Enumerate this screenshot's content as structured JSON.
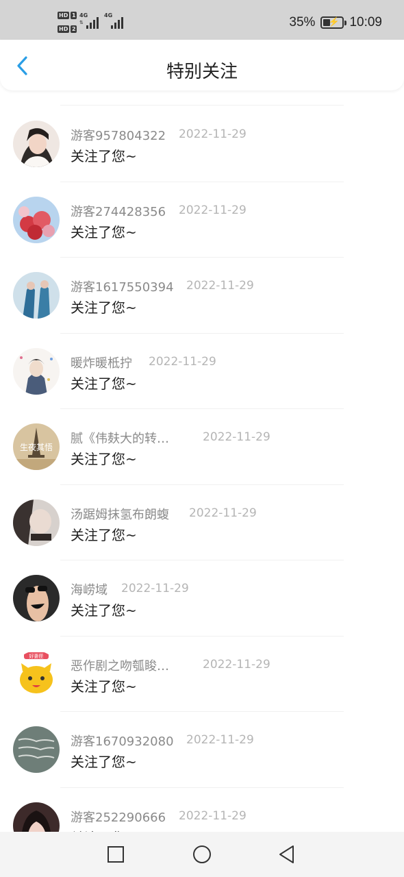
{
  "status_bar": {
    "hd_label": "HD",
    "sim1": "1",
    "sim2": "2",
    "network": "4G",
    "battery_percent": "35%",
    "battery_level": 0.35,
    "time": "10:09"
  },
  "header": {
    "title": "特别关注",
    "back_icon": "chevron-left-icon",
    "accent_color": "#2a9ee6"
  },
  "list": {
    "items": [
      {
        "name": "游客957804322",
        "date": "2022-11-29",
        "message": "关注了您~"
      },
      {
        "name": "游客274428356",
        "date": "2022-11-29",
        "message": "关注了您~"
      },
      {
        "name": "游客1617550394",
        "date": "2022-11-29",
        "message": "关注了您~"
      },
      {
        "name": "暖炸暖柢拧",
        "date": "2022-11-29",
        "message": "关注了您~"
      },
      {
        "name": "腻《伟麸大的转…",
        "date": "2022-11-29",
        "message": "关注了您~",
        "avatar_text": "生夜其悟"
      },
      {
        "name": "汤踞姆抹氢布朗蝮",
        "date": "2022-11-29",
        "message": "关注了您~"
      },
      {
        "name": "海崂域",
        "date": "2022-11-29",
        "message": "关注了您~"
      },
      {
        "name": "恶作剧之吻瓠睃…",
        "date": "2022-11-29",
        "message": "关注了您~",
        "avatar_text": "好妻匣"
      },
      {
        "name": "游客1670932080",
        "date": "2022-11-29",
        "message": "关注了您~"
      },
      {
        "name": "游客252290666",
        "date": "2022-11-29",
        "message": "关注了您~"
      }
    ]
  },
  "nav_bar": {
    "icons": [
      "square-recents-icon",
      "circle-home-icon",
      "triangle-back-icon"
    ]
  }
}
